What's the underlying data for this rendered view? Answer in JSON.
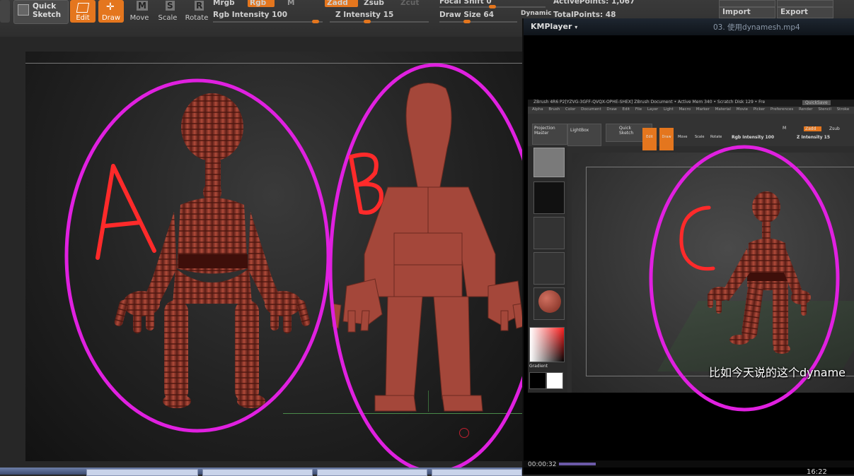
{
  "toolbar": {
    "quick_sketch": "Quick\nSketch",
    "edit": "Edit",
    "draw": "Draw",
    "move": "Move",
    "scale": "Scale",
    "rotate": "Rotate",
    "mrgb": "Mrgb",
    "rgb": "Rgb",
    "m": "M",
    "rgb_intensity": "Rgb Intensity 100",
    "zadd": "Zadd",
    "zsub": "Zsub",
    "zcut": "Zcut",
    "z_intensity": "Z Intensity 15",
    "focal_shift": "Focal Shift 0",
    "draw_size": "Draw Size 64",
    "dynamic": "Dynamic",
    "active_points": "ActivePoints: 1,067",
    "total_points": "TotalPoints: 48",
    "import": "Import",
    "export": "Export"
  },
  "annotations": {
    "label_a": "A",
    "label_b": "B",
    "label_c": "C",
    "ellipse_color": "#e020e0",
    "letter_color": "#ff2a2a"
  },
  "player": {
    "app_name": "KMPlayer",
    "file_name": "03. 使用dynamesh.mp4",
    "subtitle": "比如今天说的这个dyname",
    "time": "00:00:32",
    "clock": "16:22"
  },
  "inner_zbrush": {
    "title": "ZBrush 4R6 P2[YZVG-3GFF-QVQX-OPHE-SHEX]   ZBrush Document   • Active Mem 340 • Scratch Disk 129 • Fre",
    "quicksave": "QuickSave",
    "menu": [
      "Alpha",
      "Brush",
      "Color",
      "Document",
      "Draw",
      "Edit",
      "File",
      "Layer",
      "Light",
      "Macro",
      "Marker",
      "Material",
      "Movie",
      "Picker",
      "Preferences",
      "Render",
      "Stencil",
      "Stroke",
      "Texture"
    ],
    "projection_master": "Projection\nMaster",
    "lightbox": "LightBox",
    "quick_sketch": "Quick\nSketch",
    "edit": "Edit",
    "draw": "Draw",
    "move": "Move",
    "scale": "Scale",
    "rotate": "Rotate",
    "rgb_intensity": "Rgb Intensity 100",
    "z_intensity": "Z Intensity 15",
    "zadd": "Zadd",
    "zsub": "Zsub",
    "m": "M",
    "gradient": "Gradient"
  }
}
